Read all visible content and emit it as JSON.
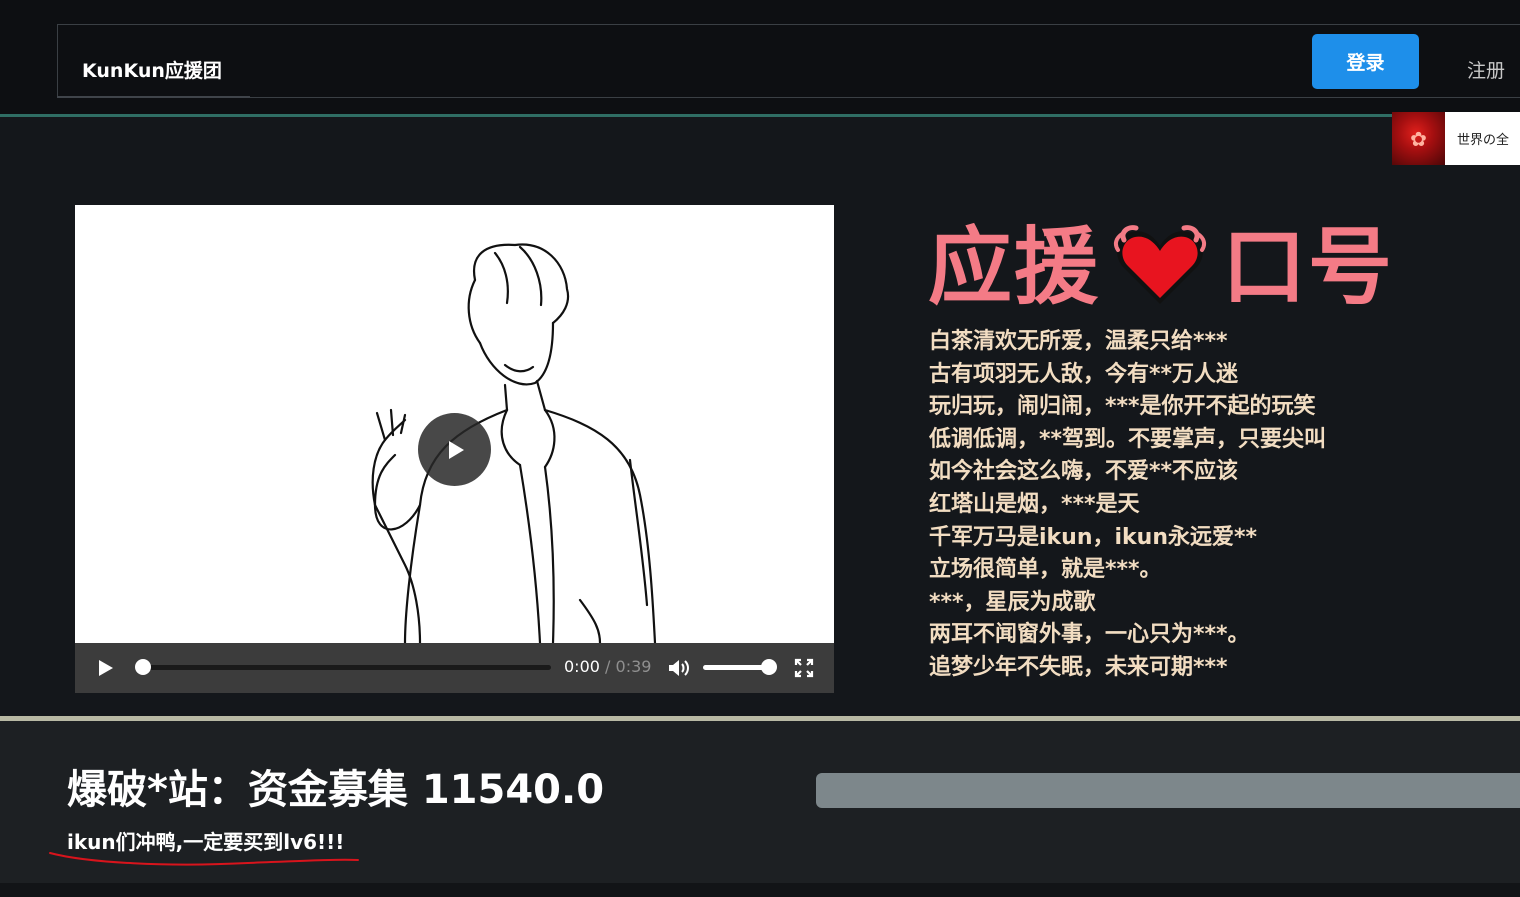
{
  "header": {
    "brand": "KunKun应援团",
    "login_label": "登录",
    "register_label": "注册"
  },
  "music": {
    "title": "世界の全"
  },
  "video": {
    "current_time": "0:00",
    "separator": "/",
    "duration": "0:39",
    "progress": 0,
    "volume": 1
  },
  "slogan": {
    "title_left": "应援",
    "title_right": "口号",
    "lines": [
      "白茶清欢无所爱，温柔只给***",
      "古有项羽无人敌，今有**万人迷",
      "玩归玩，闹归闹，***是你开不起的玩笑",
      "低调低调，**驾到。不要掌声，只要尖叫",
      "如今社会这么嗨，不爱**不应该",
      "红塔山是烟，***是天",
      "千军万马是ikun，ikun永远爱**",
      "立场很简单，就是***。",
      "***，星辰为成歌",
      "两耳不闻窗外事，一心只为***。",
      "追梦少年不失眠，未来可期***"
    ]
  },
  "fund": {
    "title": "爆破*站：资金募集 11540.0",
    "subtitle": "ikun们冲鸭,一定要买到lv6!!!"
  },
  "colors": {
    "accent_blue": "#1e8fea",
    "slogan_pink": "#f47b86",
    "slogan_text": "#f2ddc2",
    "heart_red": "#e8141f"
  }
}
